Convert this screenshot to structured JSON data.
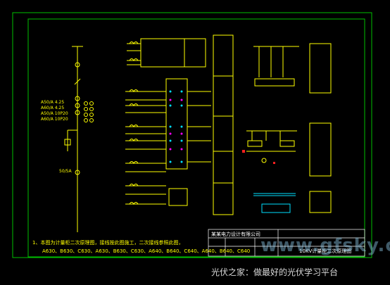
{
  "drawing": {
    "colors": {
      "background": "#000000",
      "frame": "#00c000",
      "lines": "#ffff00",
      "text": "#ffffff",
      "cyan": "#00e0ff",
      "magenta": "#ff00ff",
      "red": "#ff2020"
    },
    "left_column": {
      "feeder_labels": [
        "A50/A  4.25",
        "A60/A  4.25",
        "A50/A  10P20",
        "A60/A  10P20"
      ],
      "bottom_label": "50/5A"
    },
    "notes": {
      "line1": "1、本图为计量柜二次原理图，接线按此图施工，二次接线参照此图，",
      "line2": "A630、B630、C630、A630、B630、C630、A640、B640、C640、A640、B640、C640"
    },
    "title_block": {
      "company": "某某电力设计有限公司",
      "drawing_title": "10KV计量柜二次原理图"
    },
    "watermark": {
      "site": "www.gfsky.com",
      "slogan": "光伏之家：做最好的光伏学习平台"
    }
  }
}
